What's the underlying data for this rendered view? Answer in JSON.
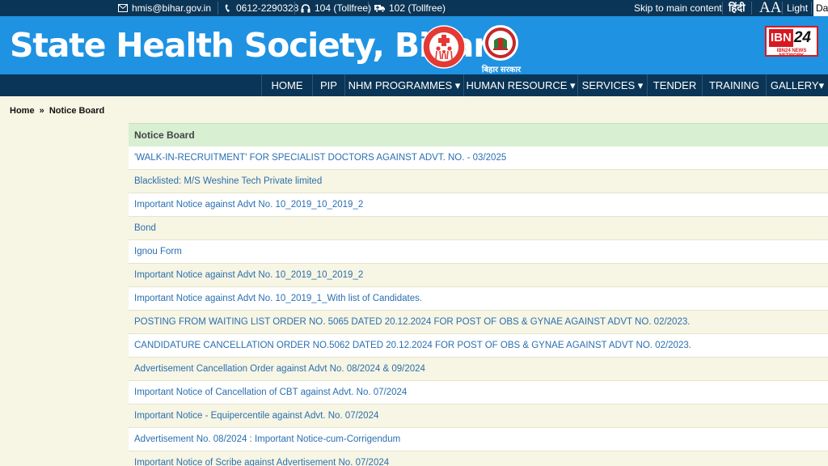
{
  "topbar": {
    "email": "hmis@bihar.gov.in",
    "phone": "0612-2290328",
    "tollfree_104": "104 (Tollfree)",
    "tollfree_102": "102 (Tollfree)",
    "skip_link": "Skip to main content",
    "hindi": "हिंदी",
    "font_size": "AA",
    "light": "Light",
    "dark": "Dar"
  },
  "header": {
    "title": "State Health Society, Bihar",
    "bihar_logo_text": "बिहार सरकार",
    "ibn_logo": {
      "main": "IBN",
      "number": "24",
      "sub": "IBN24 NEWS NETWORK"
    }
  },
  "nav": {
    "items": [
      {
        "label": "HOME"
      },
      {
        "label": "PIP"
      },
      {
        "label": "NHM PROGRAMMES ▾"
      },
      {
        "label": "HUMAN RESOURCE ▾"
      },
      {
        "label": "SERVICES ▾"
      },
      {
        "label": "TENDER"
      },
      {
        "label": "TRAINING"
      },
      {
        "label": "GALLERY▾"
      }
    ]
  },
  "breadcrumb": {
    "home": "Home",
    "separator": "»",
    "current": "Notice Board"
  },
  "notice_board": {
    "heading": "Notice Board",
    "notices": [
      "'WALK-IN-RECRUITMENT' FOR SPECIALIST DOCTORS AGAINST ADVT. NO. - 03/2025",
      "Blacklisted: M/S Weshine Tech Private limited",
      "Important Notice against Advt No. 10_2019_10_2019_2",
      "Bond",
      "Ignou Form",
      "Important Notice against Advt No. 10_2019_10_2019_2",
      "Important Notice against Advt No. 10_2019_1_With list of Candidates.",
      "POSTING FROM WAITING LIST ORDER NO. 5065 DATED 20.12.2024 FOR POST OF OBS & GYNAE AGAINST ADVT NO. 02/2023.",
      "CANDIDATURE CANCELLATION ORDER NO.5062 DATED 20.12.2024 FOR POST OF OBS & GYNAE AGAINST ADVT NO. 02/2023.",
      "Advertisement Cancellation Order against Advt No. 08/2024 & 09/2024",
      "Important Notice of Cancellation of CBT against Advt. No. 07/2024",
      "Important Notice - Equipercentile against Advt. No. 07/2024",
      "Advertisement No. 08/2024 : Important Notice-cum-Corrigendum",
      "Important Notice of Scribe against Advertisement No. 07/2024"
    ]
  },
  "colors": {
    "topbar_bg": "#0b3556",
    "header_bg": "#1f92e2",
    "nav_bg": "#0b3556",
    "page_bg": "#f7f5e3",
    "board_head_bg": "#d8efd2",
    "link": "#2a6fb0"
  }
}
